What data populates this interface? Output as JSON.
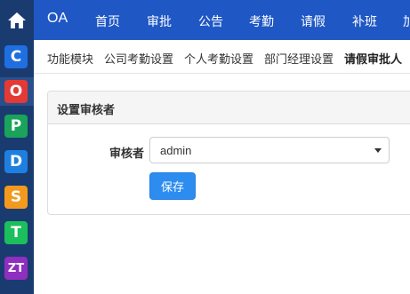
{
  "sidebar": {
    "home_icon": "home-icon",
    "apps": [
      {
        "glyph": "C",
        "color": "#1f6fe0"
      },
      {
        "glyph": "O",
        "color": "#e53935"
      },
      {
        "glyph": "P",
        "color": "#1aa35a"
      },
      {
        "glyph": "D",
        "color": "#1e7fe0"
      },
      {
        "glyph": "S",
        "color": "#f39a1e"
      },
      {
        "glyph": "T",
        "color": "#1bbf5c"
      },
      {
        "glyph": "ZT",
        "color": "#8e2fc0"
      }
    ]
  },
  "topnav": {
    "brand": "OA",
    "items": [
      "首页",
      "审批",
      "公告",
      "考勤",
      "请假",
      "补班",
      "加"
    ]
  },
  "subnav": {
    "items": [
      "功能模块",
      "公司考勤设置",
      "个人考勤设置",
      "部门经理设置",
      "请假审批人"
    ]
  },
  "panel": {
    "title": "设置审核者",
    "reviewer_label": "审核者",
    "reviewer_value": "admin",
    "save_label": "保存"
  }
}
